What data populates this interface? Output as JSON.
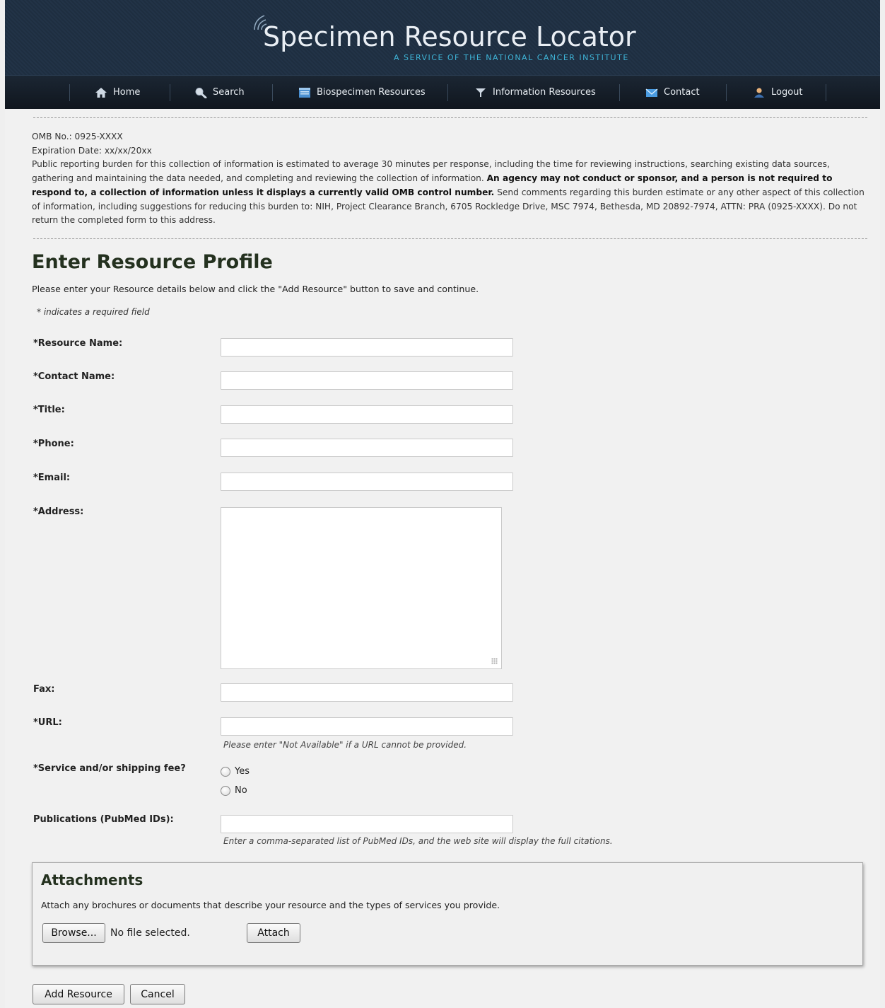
{
  "header": {
    "title": "Specimen Resource Locator",
    "subtitle": "A SERVICE OF THE NATIONAL CANCER INSTITUTE"
  },
  "nav": {
    "items": [
      {
        "label": "Home",
        "icon": "home-icon"
      },
      {
        "label": "Search",
        "icon": "search-icon"
      },
      {
        "label": "Biospecimen Resources",
        "icon": "biospecimen-icon"
      },
      {
        "label": "Information Resources",
        "icon": "information-icon"
      },
      {
        "label": "Contact",
        "icon": "envelope-icon"
      },
      {
        "label": "Logout",
        "icon": "user-icon"
      }
    ]
  },
  "notice": {
    "omb": "OMB No.: 0925-XXXX",
    "expiration": "Expiration Date: xx/xx/20xx",
    "text_before": "Public reporting burden for this collection of information is estimated to average 30 minutes per response, including the time for reviewing instructions, searching existing data sources, gathering and maintaining the data needed, and completing and reviewing the collection of information. ",
    "bold": "An agency may not conduct or sponsor, and a person is not required to respond to, a collection of information unless it displays a currently valid OMB control number.",
    "text_after": " Send comments regarding this burden estimate or any other aspect of this collection of information, including suggestions for reducing this burden to: NIH, Project Clearance Branch, 6705 Rockledge Drive, MSC 7974, Bethesda, MD 20892-7974, ATTN: PRA (0925-XXXX). Do not return the completed form to this address."
  },
  "form": {
    "title": "Enter Resource Profile",
    "instructions": "Please enter your Resource details below and click the \"Add Resource\" button to save and continue.",
    "required_note": "* indicates a required field",
    "labels": {
      "resource_name": "*Resource Name:",
      "contact_name": "*Contact Name:",
      "title": "*Title:",
      "phone": "*Phone:",
      "email": "*Email:",
      "address": "*Address:",
      "fax": "Fax:",
      "url": "*URL:",
      "fee": "*Service and/or shipping fee?",
      "publications": "Publications (PubMed IDs):"
    },
    "values": {
      "resource_name": "",
      "contact_name": "",
      "title": "",
      "phone": "",
      "email": "",
      "address": "",
      "fax": "",
      "url": "",
      "publications": ""
    },
    "url_hint": "Please enter \"Not Available\" if a URL cannot be provided.",
    "fee_options": [
      "Yes",
      "No"
    ],
    "publications_hint": "Enter a comma-separated list of PubMed IDs, and the web site will display the full citations."
  },
  "attachments": {
    "title": "Attachments",
    "text": "Attach any brochures or documents that describe your resource and the types of services you provide.",
    "browse_label": "Browse...",
    "file_status": "No file selected.",
    "attach_label": "Attach"
  },
  "actions": {
    "add_label": "Add Resource",
    "cancel_label": "Cancel"
  },
  "colors": {
    "header_bg": "#1f3044",
    "nav_bg": "#141c26",
    "accent": "#3fb5d8",
    "title_green": "#24311f"
  }
}
